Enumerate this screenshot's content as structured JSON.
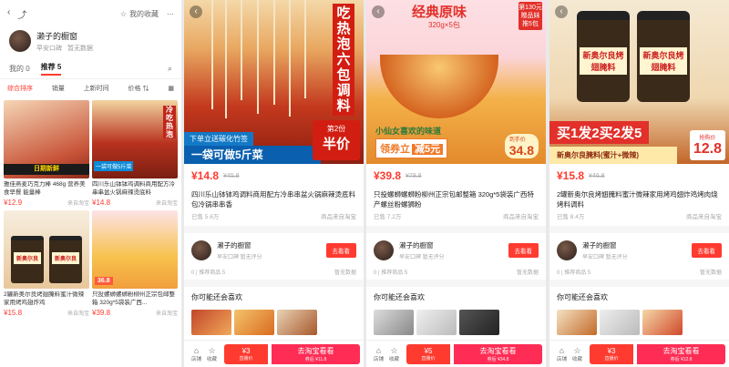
{
  "shop": {
    "fav_label": "我的收藏",
    "name": "濑子的橱窗",
    "auth": "早安口碑",
    "no_data": "暂无数据",
    "tabs": [
      "我的 0",
      "推荐 5"
    ],
    "sort": [
      "综合排序",
      "销量",
      "上新时间",
      "价格"
    ],
    "items": [
      {
        "title": "雅佳燕麦巧克力棒 468g 营养美食早餐 能量棒",
        "price": "¥12.9",
        "source": "来自淘宝",
        "banner": "日期新鲜"
      },
      {
        "title": "四川乐山钵钵鸡调料商用配方冷串串盆火锅麻辣烫底料",
        "price": "¥14.8",
        "source": "来自淘宝",
        "tag": "一袋可做5斤菜",
        "vtext": "冷吃热泡"
      },
      {
        "title": "2罐新奥尔良烤翅腌料蜜汁微辣家用烤鸡翅炸鸡",
        "price": "¥15.8",
        "source": "来自淘宝",
        "label": "新奥尔良"
      },
      {
        "title": "只投螺蛳螺蛳粉柳州正宗包邮整箱 320g*5袋装广西...",
        "price": "¥39.8",
        "source": "来自淘宝",
        "price_tag": "36.8"
      }
    ]
  },
  "panes": [
    {
      "hero": {
        "vtext": "吃热泡六包调料",
        "blue": "下单立送碳化竹签",
        "bar": "一袋可做5斤菜",
        "badge_a": "第2份",
        "badge_b": "半价"
      },
      "price": "¥14.8",
      "old_price": "¥45.8",
      "title": "四川乐山钵钵鸡调料商用配方冷串串盆火锅麻辣烫底料包冷锅串串香",
      "sold": "已售 5.6万",
      "source": "商品来自淘宝",
      "seller": {
        "name": "濑子的橱窗",
        "sub": "早安口碑  暂无评分",
        "btn": "去看看",
        "stats": [
          "0 | 推荐商品 5",
          "暂无数据"
        ]
      },
      "like": "你可能还会喜欢",
      "bar": {
        "icon1": "店铺",
        "icon2": "收藏",
        "coupon": "¥3",
        "coupon_sub": "直播价",
        "go": "去淘宝看看",
        "go_sub": "券后 ¥11.8"
      }
    },
    {
      "hero": {
        "head": "经典原味",
        "sub": "320g×5包",
        "gift": "第130元赠品妹推5包",
        "slogan": "小仙女喜欢的味道",
        "coupon": "领券立",
        "coupon_b": "减5元",
        "newprice": "34.8",
        "newprice_label": "到手价"
      },
      "price": "¥39.8",
      "old_price": "¥78.8",
      "title": "只投螺蛳螺蛳粉柳州正宗包邮整箱 320g*5袋装广西特产螺丝粉螺狮粉",
      "sold": "已售 7.2万",
      "source": "商品来自淘宝",
      "seller": {
        "name": "濑子的橱窗",
        "sub": "早安口碑  暂无评分",
        "btn": "去看看",
        "stats": [
          "0 | 推荐商品 5",
          "暂无数据"
        ]
      },
      "like": "你可能还会喜欢",
      "bar": {
        "icon1": "店铺",
        "icon2": "收藏",
        "coupon": "¥5",
        "coupon_sub": "直播价",
        "go": "去淘宝看看",
        "go_sub": "券后 ¥34.8"
      }
    },
    {
      "hero": {
        "jar_label": "新奥尔良烤翅腌料",
        "promo": "买1发2买2发5",
        "sub": "新奥尔良腌料(蜜汁+微辣)",
        "rush_label": "抢购价",
        "rush": "12.8"
      },
      "price": "¥15.8",
      "old_price": "¥46.8",
      "title": "2罐新奥尔良烤翅腌料蜜汁微辣家用烤鸡翅炸鸡烤肉烧烤料调料",
      "sold": "已售 8.4万",
      "source": "商品来自淘宝",
      "seller": {
        "name": "濑子的橱窗",
        "sub": "早安口碑  暂无评分",
        "btn": "去看看",
        "stats": [
          "0 | 推荐商品 5",
          "暂无数据"
        ]
      },
      "like": "你可能还会喜欢",
      "bar": {
        "icon1": "店铺",
        "icon2": "收藏",
        "coupon": "¥3",
        "coupon_sub": "直播价",
        "go": "去淘宝看看",
        "go_sub": "券后 ¥12.8"
      }
    }
  ]
}
